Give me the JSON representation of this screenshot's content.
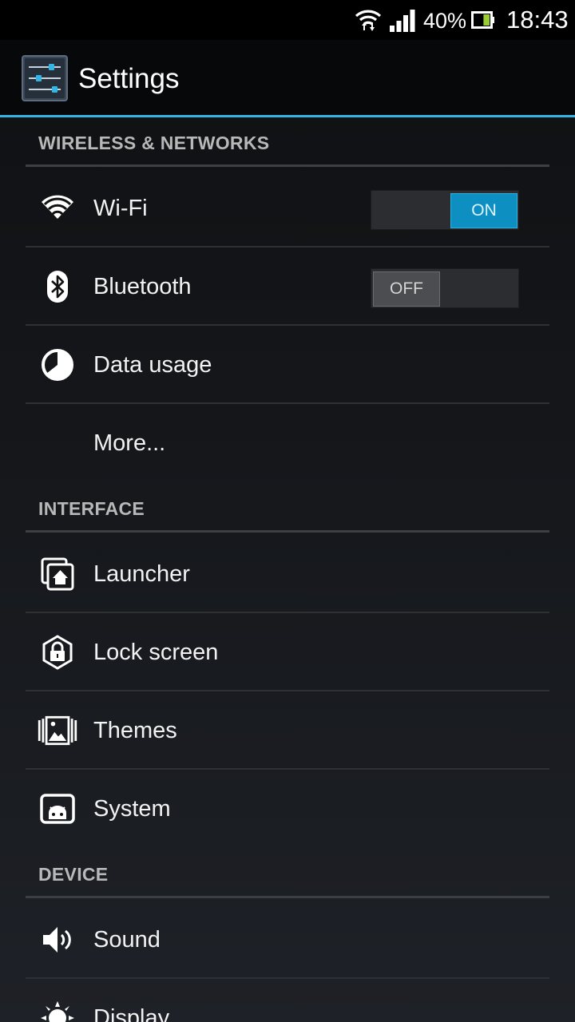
{
  "status_bar": {
    "battery_percent": "40%",
    "battery_level": 0.4,
    "clock": "18:43",
    "icons": [
      "wifi-data-icon",
      "signal-strength-icon",
      "battery-icon"
    ]
  },
  "action_bar": {
    "title": "Settings",
    "icon": "settings-sliders-icon"
  },
  "colors": {
    "accent": "#33b5e5",
    "toggle_on": "#0e8fc1",
    "background": "#15171b"
  },
  "sections": {
    "wireless": {
      "header": "WIRELESS & NETWORKS",
      "items": [
        {
          "label": "Wi-Fi",
          "icon": "wifi-icon",
          "toggle": "ON",
          "toggle_state": true
        },
        {
          "label": "Bluetooth",
          "icon": "bluetooth-icon",
          "toggle": "OFF",
          "toggle_state": false
        },
        {
          "label": "Data usage",
          "icon": "data-usage-icon"
        },
        {
          "label": "More..."
        }
      ]
    },
    "interface": {
      "header": "INTERFACE",
      "items": [
        {
          "label": "Launcher",
          "icon": "launcher-icon"
        },
        {
          "label": "Lock screen",
          "icon": "lock-icon"
        },
        {
          "label": "Themes",
          "icon": "themes-icon"
        },
        {
          "label": "System",
          "icon": "system-icon"
        }
      ]
    },
    "device": {
      "header": "DEVICE",
      "items": [
        {
          "label": "Sound",
          "icon": "sound-icon"
        },
        {
          "label": "Display",
          "icon": "display-icon"
        }
      ]
    }
  }
}
